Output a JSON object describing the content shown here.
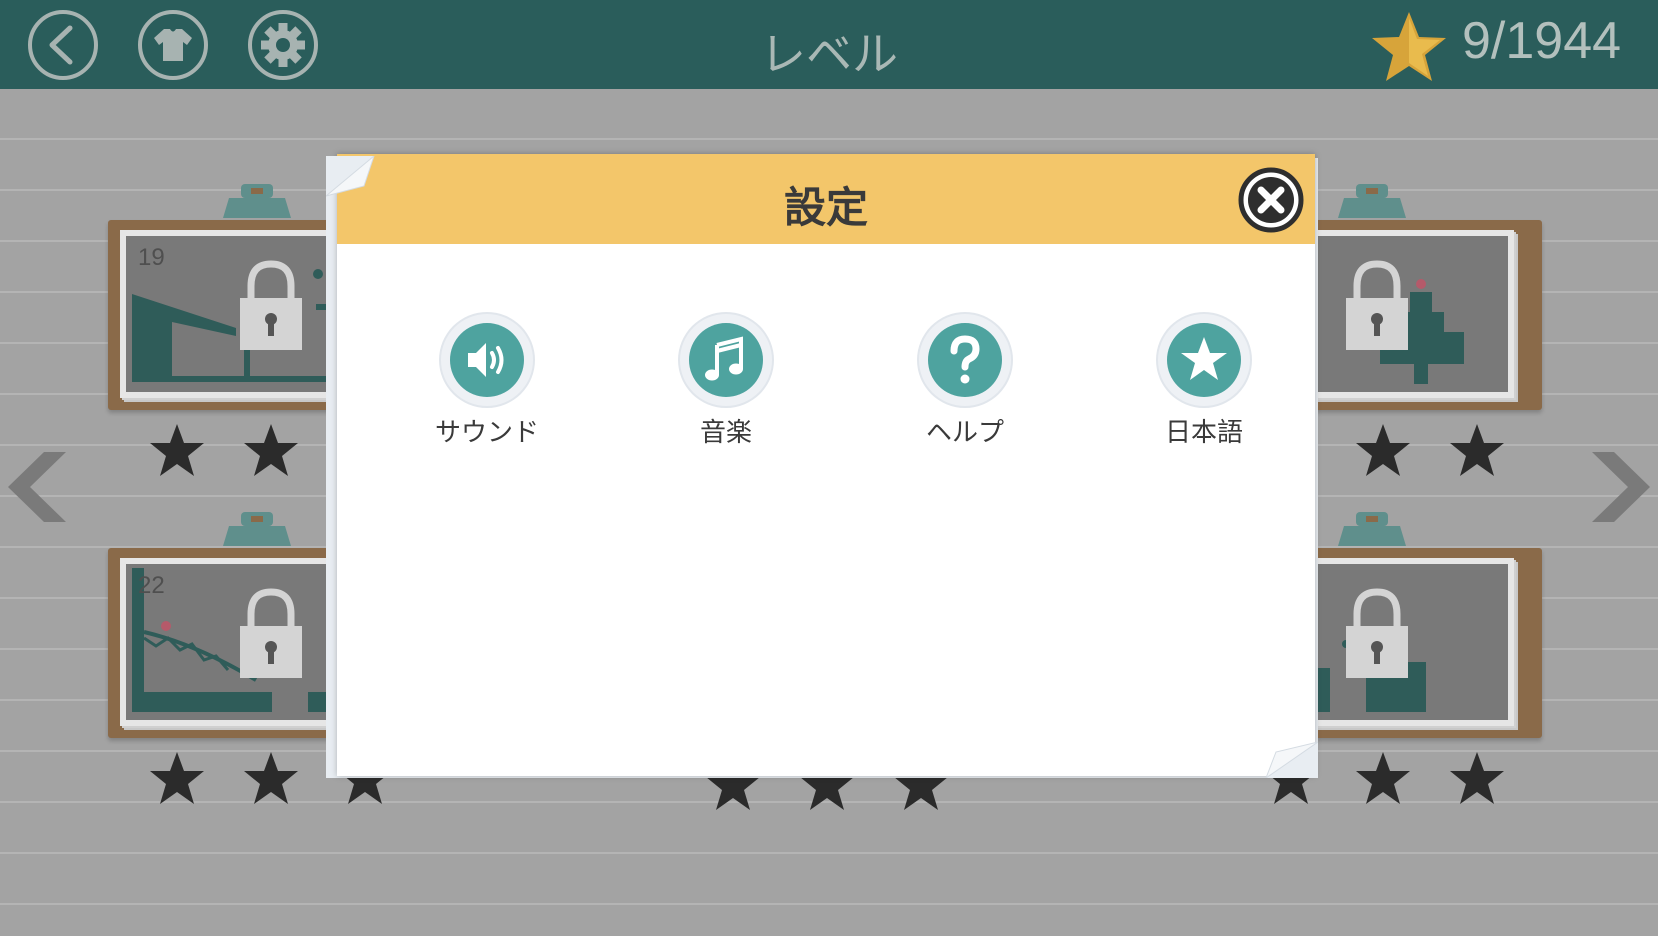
{
  "topbar": {
    "title": "レベル",
    "score": "9/1944",
    "buttons": [
      {
        "name": "back-button",
        "icon": "chevron-left-icon"
      },
      {
        "name": "skins-button",
        "icon": "shirt-icon"
      },
      {
        "name": "settings-button",
        "icon": "gear-icon"
      }
    ]
  },
  "levels": [
    {
      "number": "19",
      "locked": true,
      "stars": 3
    },
    {
      "number": "",
      "locked": true,
      "stars": 3
    },
    {
      "number": "22",
      "locked": true,
      "stars": 3
    },
    {
      "number": "",
      "locked": true,
      "stars": 3
    }
  ],
  "dialog": {
    "title": "設定",
    "close_icon": "close-icon",
    "options": [
      {
        "label": "サウンド",
        "icon": "speaker-icon"
      },
      {
        "label": "音楽",
        "icon": "music-note-icon"
      },
      {
        "label": "ヘルプ",
        "icon": "question-icon"
      },
      {
        "label": "日本語",
        "icon": "star-icon"
      }
    ]
  },
  "colors": {
    "topbar": "#2a5d5b",
    "accent_teal": "#4ea39f",
    "dialog_header": "#f3c66a",
    "board_frame": "#8a6a49",
    "background": "#a3a3a3"
  }
}
